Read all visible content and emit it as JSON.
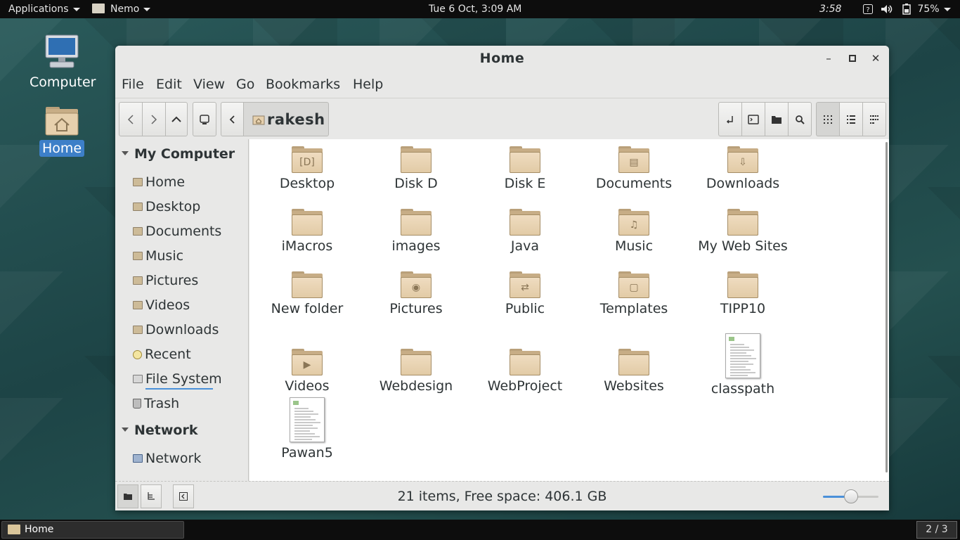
{
  "topbar": {
    "applications_label": "Applications",
    "app_name": "Nemo",
    "datetime": "Tue  6 Oct,  3:09 AM",
    "time_right": "3:58",
    "battery": "75%"
  },
  "desktop": {
    "icons": [
      {
        "label": "Computer"
      },
      {
        "label": "Home"
      }
    ]
  },
  "window": {
    "title": "Home",
    "menu": [
      "File",
      "Edit",
      "View",
      "Go",
      "Bookmarks",
      "Help"
    ],
    "breadcrumb": "rakesh"
  },
  "sidebar": {
    "sections": [
      {
        "title": "My Computer"
      },
      {
        "title": "Network"
      }
    ],
    "my_computer_items": [
      "Home",
      "Desktop",
      "Documents",
      "Music",
      "Pictures",
      "Videos",
      "Downloads",
      "Recent",
      "File System",
      "Trash"
    ],
    "network_items": [
      "Network"
    ]
  },
  "files": [
    {
      "name": "Desktop",
      "type": "folder",
      "emblem": "desktop"
    },
    {
      "name": "Disk D",
      "type": "folder",
      "emblem": ""
    },
    {
      "name": "Disk E",
      "type": "folder",
      "emblem": ""
    },
    {
      "name": "Documents",
      "type": "folder",
      "emblem": "documents"
    },
    {
      "name": "Downloads",
      "type": "folder",
      "emblem": "downloads"
    },
    {
      "name": "iMacros",
      "type": "folder",
      "emblem": ""
    },
    {
      "name": "images",
      "type": "folder",
      "emblem": ""
    },
    {
      "name": "Java",
      "type": "folder",
      "emblem": ""
    },
    {
      "name": "Music",
      "type": "folder",
      "emblem": "music"
    },
    {
      "name": "My Web Sites",
      "type": "folder",
      "emblem": ""
    },
    {
      "name": "New folder",
      "type": "folder",
      "emblem": ""
    },
    {
      "name": "Pictures",
      "type": "folder",
      "emblem": "pictures"
    },
    {
      "name": "Public",
      "type": "folder",
      "emblem": "public"
    },
    {
      "name": "Templates",
      "type": "folder",
      "emblem": "templates"
    },
    {
      "name": "TIPP10",
      "type": "folder",
      "emblem": ""
    },
    {
      "name": "Videos",
      "type": "folder",
      "emblem": "videos"
    },
    {
      "name": "Webdesign",
      "type": "folder",
      "emblem": ""
    },
    {
      "name": "WebProject",
      "type": "folder",
      "emblem": ""
    },
    {
      "name": "Websites",
      "type": "folder",
      "emblem": ""
    },
    {
      "name": "classpath",
      "type": "document",
      "emblem": ""
    },
    {
      "name": "Pawan5",
      "type": "document",
      "emblem": ""
    }
  ],
  "status": {
    "text": "21 items, Free space: 406.1 GB",
    "zoom_fraction": 0.5
  },
  "taskbar": {
    "task_label": "Home",
    "workspace": "2 / 3"
  }
}
